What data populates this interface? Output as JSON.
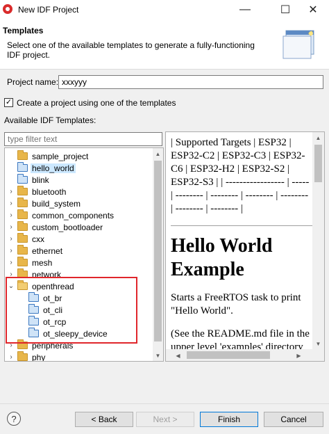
{
  "window": {
    "title": "New IDF Project",
    "minimize_glyph": "—",
    "maximize_glyph": "☐",
    "close_glyph": "✕"
  },
  "header": {
    "title": "Templates",
    "description": "Select one of the available templates to generate a fully-functioning IDF project."
  },
  "form": {
    "project_name_label": "Project name:",
    "project_name_value": "xxxyyy",
    "use_template_checked": true,
    "use_template_label": "Create a project using one of the templates",
    "templates_label": "Available IDF Templates:",
    "filter_placeholder": "type filter text"
  },
  "tree": {
    "items": [
      {
        "label": "sample_project",
        "chevron": "",
        "folder": "yellow"
      },
      {
        "label": "hello_world",
        "chevron": "",
        "folder": "blue",
        "selected": true
      },
      {
        "label": "blink",
        "chevron": "",
        "folder": "blue"
      },
      {
        "label": "bluetooth",
        "chevron": "›",
        "folder": "yellow"
      },
      {
        "label": "build_system",
        "chevron": "›",
        "folder": "yellow"
      },
      {
        "label": "common_components",
        "chevron": "›",
        "folder": "yellow"
      },
      {
        "label": "custom_bootloader",
        "chevron": "›",
        "folder": "yellow"
      },
      {
        "label": "cxx",
        "chevron": "›",
        "folder": "yellow"
      },
      {
        "label": "ethernet",
        "chevron": "›",
        "folder": "yellow"
      },
      {
        "label": "mesh",
        "chevron": "›",
        "folder": "yellow"
      },
      {
        "label": "network",
        "chevron": "›",
        "folder": "yellow"
      },
      {
        "label": "openthread",
        "chevron": "⌄",
        "folder": "yellow"
      },
      {
        "label": "ot_br",
        "chevron": "",
        "folder": "blue",
        "indent": 1
      },
      {
        "label": "ot_cli",
        "chevron": "",
        "folder": "blue",
        "indent": 1
      },
      {
        "label": "ot_rcp",
        "chevron": "",
        "folder": "blue",
        "indent": 1
      },
      {
        "label": "ot_sleepy_device",
        "chevron": "",
        "folder": "blue",
        "indent": 1
      },
      {
        "label": "peripherals",
        "chevron": "›",
        "folder": "yellow"
      },
      {
        "label": "phy",
        "chevron": "›",
        "folder": "yellow"
      }
    ]
  },
  "readme": {
    "table_text": "| Supported Targets | ESP32 | ESP32-C2 | ESP32-C3 | ESP32-C6 | ESP32-H2 | ESP32-S2 | ESP32-S3 | | ----------------- | ----- | -------- | -------- | -------- | -------- | -------- | -------- |",
    "heading": "Hello World Example",
    "para1": "Starts a FreeRTOS task to print \"Hello World\".",
    "para2": "(See the README.md file in the upper level 'examples' directory for more information about examples.)"
  },
  "footer": {
    "help_glyph": "?",
    "back_label": "< Back",
    "next_label": "Next >",
    "finish_label": "Finish",
    "cancel_label": "Cancel"
  },
  "colors": {
    "highlight_box": "#e0262b",
    "selection": "#cce8ff",
    "default_button_border": "#0078d7"
  }
}
